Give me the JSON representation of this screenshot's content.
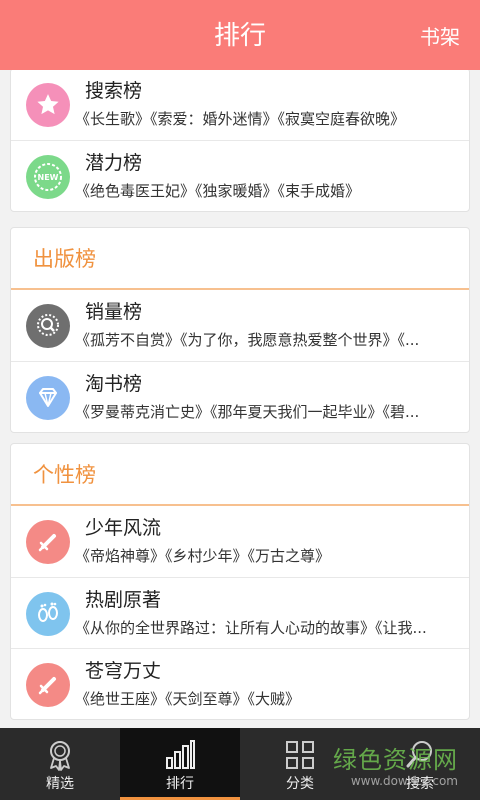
{
  "header": {
    "title": "排行",
    "right_button": "书架",
    "color": "#fa7c78"
  },
  "top_card": {
    "rows": [
      {
        "title": "搜索榜",
        "books": "《长生歌》《索爱：婚外迷情》《寂寞空庭春欲晚》",
        "icon": "star-icon",
        "icon_color": "#f590b9"
      },
      {
        "title": "潜力榜",
        "books": "《绝色毒医王妃》《独家暖婚》《束手成婚》",
        "icon": "new-badge-icon",
        "icon_color": "#7cd98a",
        "icon_text": "NEW"
      }
    ]
  },
  "publish_card": {
    "heading": "出版榜",
    "rows": [
      {
        "title": "销量榜",
        "books": "《孤芳不自赏》《为了你，我愿意热爱整个世界》《...",
        "icon": "search-badge-icon",
        "icon_color": "#6f6f6f"
      },
      {
        "title": "淘书榜",
        "books": "《罗曼蒂克消亡史》《那年夏天我们一起毕业》《碧...",
        "icon": "diamond-icon",
        "icon_color": "#8ab8f2"
      }
    ]
  },
  "personal_card": {
    "heading": "个性榜",
    "rows": [
      {
        "title": "少年风流",
        "books": "《帝焰神尊》《乡村少年》《万古之尊》",
        "icon": "sword-icon",
        "icon_color": "#f48a86"
      },
      {
        "title": "热剧原著",
        "books": "《从你的全世界路过：让所有人心动的故事》《让我...",
        "icon": "footprints-icon",
        "icon_color": "#7fc4ee"
      },
      {
        "title": "苍穹万丈",
        "books": "《绝世王座》《天剑至尊》《大贼》",
        "icon": "sword-icon",
        "icon_color": "#f48a86"
      }
    ]
  },
  "tabbar": {
    "tabs": [
      {
        "label": "精选",
        "icon": "award-ribbon-icon",
        "active": false
      },
      {
        "label": "排行",
        "icon": "bar-chart-icon",
        "active": true
      },
      {
        "label": "分类",
        "icon": "grid-icon",
        "active": false
      },
      {
        "label": "搜索",
        "icon": "search-icon",
        "active": false
      }
    ],
    "accent": "#f0923f"
  },
  "watermark": {
    "text": "绿色资源网",
    "sub": "www.downcc.com"
  }
}
